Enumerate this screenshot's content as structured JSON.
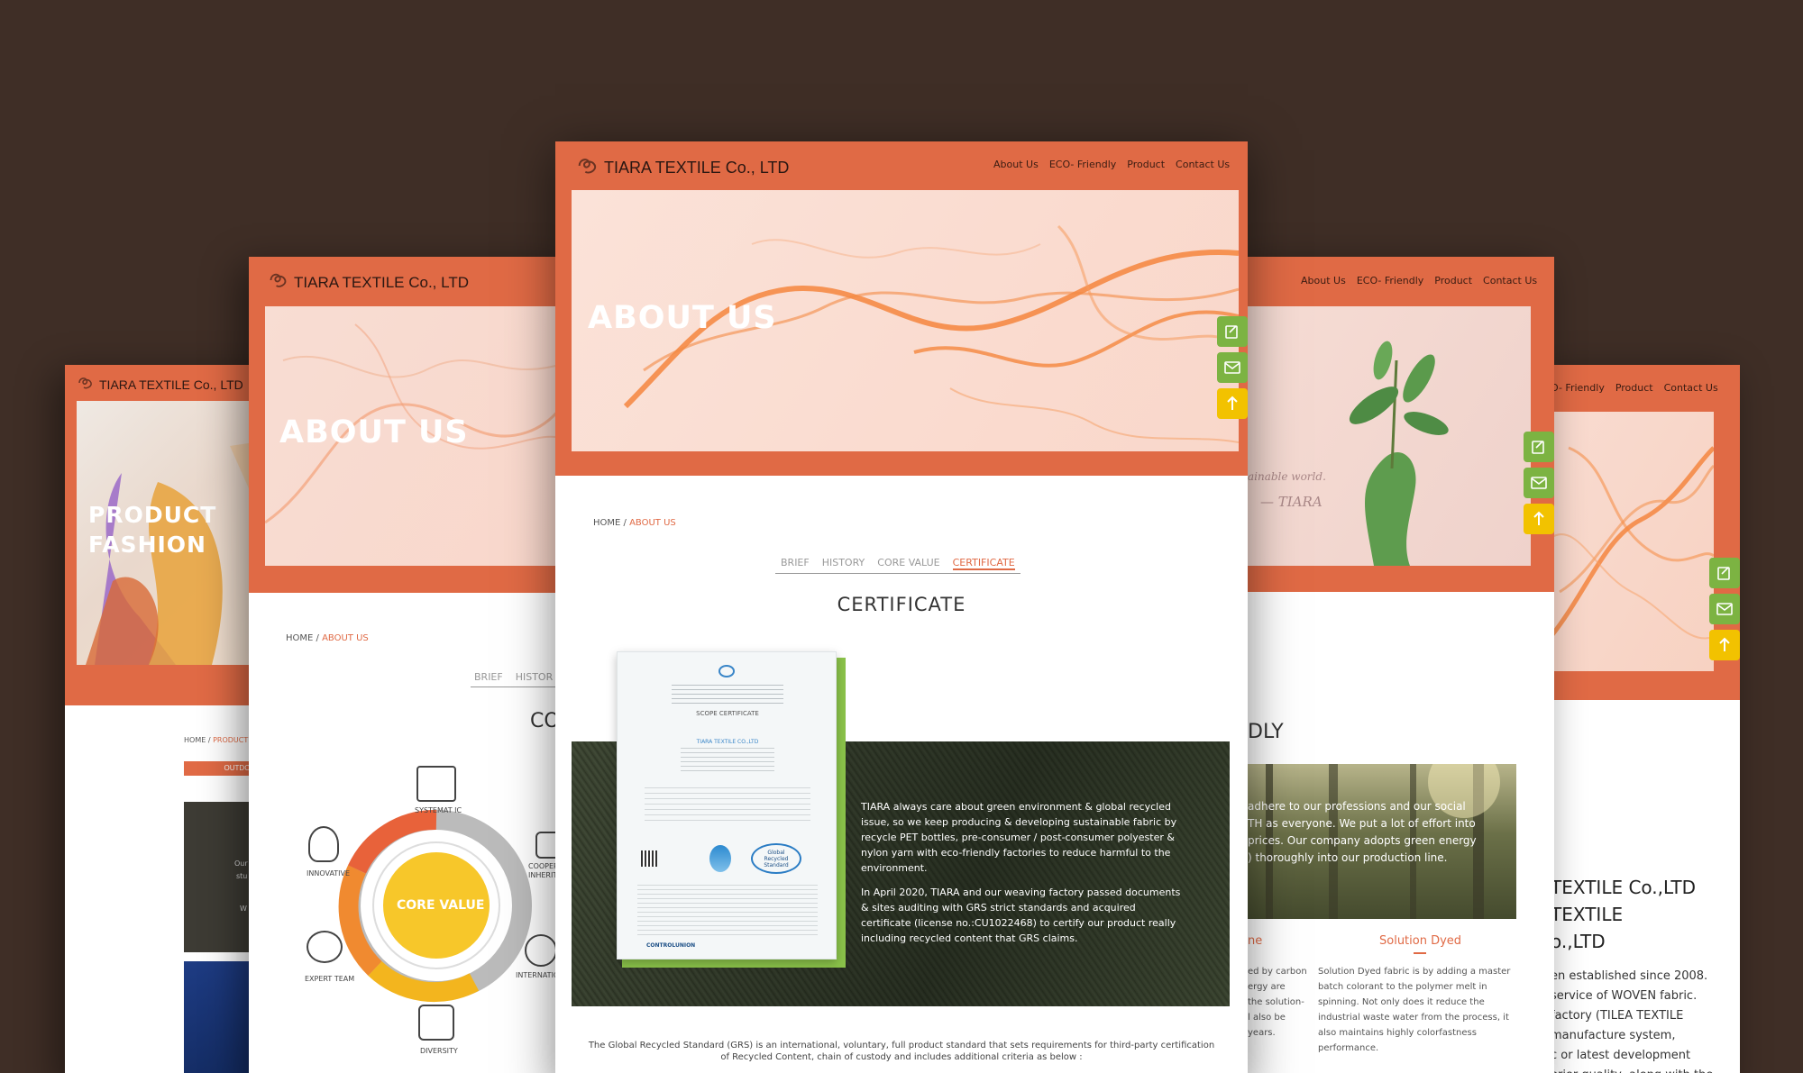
{
  "brand": {
    "name": "TIARA TEXTILE Co., LTD",
    "logo_icon": "swirl-logo-icon"
  },
  "colors": {
    "background": "#3f2e26",
    "header": "#e06a45",
    "accent": "#e06a45",
    "float_green": "#7cb342",
    "float_yellow": "#f2c200"
  },
  "nav": {
    "about": "About Us",
    "eco": "ECO- Friendly",
    "product": "Product",
    "contact": "Contact Us"
  },
  "float_buttons": {
    "form_icon": "form-edit-icon",
    "mail_icon": "mail-icon",
    "top_icon": "arrow-up-icon"
  },
  "center_page": {
    "hero_title": "ABOUT US",
    "breadcrumb": {
      "home": "HOME /",
      "current": "ABOUT US"
    },
    "tabs": [
      "BRIEF",
      "HISTORY",
      "CORE VALUE",
      "CERTIFICATE"
    ],
    "active_tab": "CERTIFICATE",
    "section_title": "CERTIFICATE",
    "certificate": {
      "heading": "SCOPE CERTIFICATE",
      "company": "TIARA TEXTILE CO.,LTD",
      "issuer": "CONTROLUNION",
      "badge": "Global Recycled Standard"
    },
    "para1": "TIARA always care about green environment & global recycled issue, so we keep producing & developing sustainable fabric by recycle PET bottles, pre-consumer / post-consumer polyester & nylon yarn with eco-friendly factories to reduce harmful to the environment.",
    "para2": "In April 2020, TIARA and our weaving factory passed documents & sites auditing with GRS strict standards and acquired certificate (license no.:CU1022468) to certify our product really including recycled content that GRS claims.",
    "footer_line1": "The Global Recycled Standard (GRS) is an international, voluntary, full product standard that sets requirements for third-party certification",
    "footer_line2": "of Recycled Content, chain of custody and includes additional criteria as below :"
  },
  "left_about_page": {
    "hero_title": "ABOUT US",
    "breadcrumb": {
      "home": "HOME /",
      "current": "ABOUT US"
    },
    "tabs": [
      "BRIEF",
      "HISTOR"
    ],
    "section_title_partial": "CO",
    "core_value_label": "CORE VALUE",
    "icons": [
      "SYSTEMAT IC",
      "INNOVATIVE",
      "COOPER INHERITA",
      "EXPERT TEAM",
      "INTERNATIO",
      "DIVERSITY"
    ]
  },
  "far_left_page": {
    "hero_line1": "PRODUCT",
    "hero_line2": "FASHION",
    "breadcrumb": {
      "home": "HOME /",
      "current": "PRODUCT"
    },
    "button": "OUTDO",
    "snippet1": "Our",
    "snippet2": "stu",
    "snippet3": "W"
  },
  "right_eco_page": {
    "hero_text1": "ainable world.",
    "hero_text2": "— TIARA",
    "section_title_partial": "DLY",
    "photo_line1": "adhere to our professions and our social",
    "photo_line2": "TH as everyone. We put a lot of effort into",
    "photo_line3": "prices. Our company adopts green energy",
    "photo_line4": ") thoroughly into our production line.",
    "col1_title": "ne",
    "col1_text": [
      "ed by carbon",
      "ergy are",
      "the solution-",
      "l also be",
      "years."
    ],
    "col2_title": "Solution Dyed",
    "col2_text": [
      "Solution Dyed fabric is by adding a master",
      "batch colorant to the polymer melt in",
      "spinning. Not only does it reduce the",
      "industrial waste water from the process, it",
      "also maintains highly colorfastness",
      "performance."
    ]
  },
  "far_right_page": {
    "nav_eco": "O- Friendly",
    "line1": "TEXTILE Co.,LTD",
    "line2": "TEXTILE",
    "line3": "o.,LTD",
    "text": [
      "en established since 2008.",
      "service of WOVEN fabric.",
      "factory (TILEA TEXTILE",
      "manufacture system,",
      "c or latest development",
      "erior quality, along with the"
    ]
  }
}
